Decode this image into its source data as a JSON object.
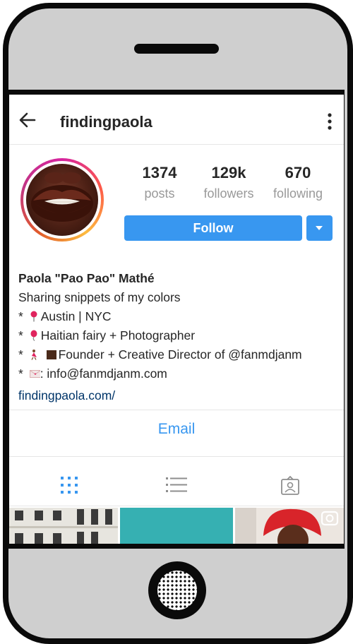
{
  "header": {
    "username": "findingpaola"
  },
  "stats": {
    "posts": {
      "value": "1374",
      "label": "posts"
    },
    "followers": {
      "value": "129k",
      "label": "followers"
    },
    "following": {
      "value": "670",
      "label": "following"
    }
  },
  "actions": {
    "follow_label": "Follow",
    "email_label": "Email"
  },
  "bio": {
    "name": "Paola \"Pao Pao\" Mathé",
    "line1": "Sharing snippets of my colors",
    "line2": "Austin | NYC",
    "line3": "Haitian fairy + Photographer",
    "line4": "Founder + Creative Director of @fanmdjanm",
    "line5": ": info@fanmdjanm.com",
    "bullet": "*",
    "website": "findingpaola.com/"
  },
  "tabs": [
    {
      "icon": "grid-icon",
      "active": true
    },
    {
      "icon": "list-icon",
      "active": false
    },
    {
      "icon": "tagged-icon",
      "active": false
    }
  ],
  "colors": {
    "accent": "#3897f0",
    "link": "#003569",
    "text": "#262626",
    "muted": "#999999"
  }
}
